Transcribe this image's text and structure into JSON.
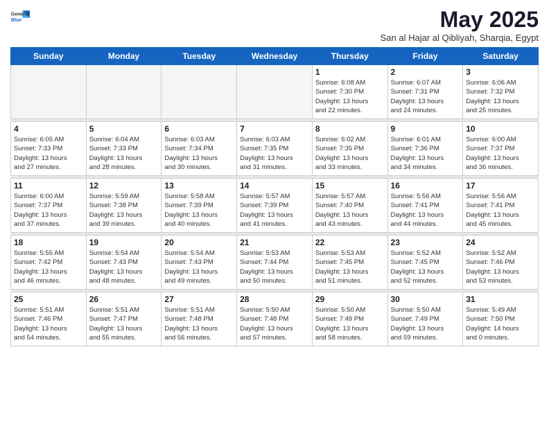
{
  "logo": {
    "general": "General",
    "blue": "Blue"
  },
  "title": "May 2025",
  "subtitle": "San al Hajar al Qibliyah, Sharqia, Egypt",
  "days_of_week": [
    "Sunday",
    "Monday",
    "Tuesday",
    "Wednesday",
    "Thursday",
    "Friday",
    "Saturday"
  ],
  "weeks": [
    [
      {
        "num": "",
        "info": ""
      },
      {
        "num": "",
        "info": ""
      },
      {
        "num": "",
        "info": ""
      },
      {
        "num": "",
        "info": ""
      },
      {
        "num": "1",
        "info": "Sunrise: 6:08 AM\nSunset: 7:30 PM\nDaylight: 13 hours\nand 22 minutes."
      },
      {
        "num": "2",
        "info": "Sunrise: 6:07 AM\nSunset: 7:31 PM\nDaylight: 13 hours\nand 24 minutes."
      },
      {
        "num": "3",
        "info": "Sunrise: 6:06 AM\nSunset: 7:32 PM\nDaylight: 13 hours\nand 25 minutes."
      }
    ],
    [
      {
        "num": "4",
        "info": "Sunrise: 6:05 AM\nSunset: 7:33 PM\nDaylight: 13 hours\nand 27 minutes."
      },
      {
        "num": "5",
        "info": "Sunrise: 6:04 AM\nSunset: 7:33 PM\nDaylight: 13 hours\nand 28 minutes."
      },
      {
        "num": "6",
        "info": "Sunrise: 6:03 AM\nSunset: 7:34 PM\nDaylight: 13 hours\nand 30 minutes."
      },
      {
        "num": "7",
        "info": "Sunrise: 6:03 AM\nSunset: 7:35 PM\nDaylight: 13 hours\nand 31 minutes."
      },
      {
        "num": "8",
        "info": "Sunrise: 6:02 AM\nSunset: 7:35 PM\nDaylight: 13 hours\nand 33 minutes."
      },
      {
        "num": "9",
        "info": "Sunrise: 6:01 AM\nSunset: 7:36 PM\nDaylight: 13 hours\nand 34 minutes."
      },
      {
        "num": "10",
        "info": "Sunrise: 6:00 AM\nSunset: 7:37 PM\nDaylight: 13 hours\nand 36 minutes."
      }
    ],
    [
      {
        "num": "11",
        "info": "Sunrise: 6:00 AM\nSunset: 7:37 PM\nDaylight: 13 hours\nand 37 minutes."
      },
      {
        "num": "12",
        "info": "Sunrise: 5:59 AM\nSunset: 7:38 PM\nDaylight: 13 hours\nand 39 minutes."
      },
      {
        "num": "13",
        "info": "Sunrise: 5:58 AM\nSunset: 7:39 PM\nDaylight: 13 hours\nand 40 minutes."
      },
      {
        "num": "14",
        "info": "Sunrise: 5:57 AM\nSunset: 7:39 PM\nDaylight: 13 hours\nand 41 minutes."
      },
      {
        "num": "15",
        "info": "Sunrise: 5:57 AM\nSunset: 7:40 PM\nDaylight: 13 hours\nand 43 minutes."
      },
      {
        "num": "16",
        "info": "Sunrise: 5:56 AM\nSunset: 7:41 PM\nDaylight: 13 hours\nand 44 minutes."
      },
      {
        "num": "17",
        "info": "Sunrise: 5:56 AM\nSunset: 7:41 PM\nDaylight: 13 hours\nand 45 minutes."
      }
    ],
    [
      {
        "num": "18",
        "info": "Sunrise: 5:55 AM\nSunset: 7:42 PM\nDaylight: 13 hours\nand 46 minutes."
      },
      {
        "num": "19",
        "info": "Sunrise: 5:54 AM\nSunset: 7:43 PM\nDaylight: 13 hours\nand 48 minutes."
      },
      {
        "num": "20",
        "info": "Sunrise: 5:54 AM\nSunset: 7:43 PM\nDaylight: 13 hours\nand 49 minutes."
      },
      {
        "num": "21",
        "info": "Sunrise: 5:53 AM\nSunset: 7:44 PM\nDaylight: 13 hours\nand 50 minutes."
      },
      {
        "num": "22",
        "info": "Sunrise: 5:53 AM\nSunset: 7:45 PM\nDaylight: 13 hours\nand 51 minutes."
      },
      {
        "num": "23",
        "info": "Sunrise: 5:52 AM\nSunset: 7:45 PM\nDaylight: 13 hours\nand 52 minutes."
      },
      {
        "num": "24",
        "info": "Sunrise: 5:52 AM\nSunset: 7:46 PM\nDaylight: 13 hours\nand 53 minutes."
      }
    ],
    [
      {
        "num": "25",
        "info": "Sunrise: 5:51 AM\nSunset: 7:46 PM\nDaylight: 13 hours\nand 54 minutes."
      },
      {
        "num": "26",
        "info": "Sunrise: 5:51 AM\nSunset: 7:47 PM\nDaylight: 13 hours\nand 55 minutes."
      },
      {
        "num": "27",
        "info": "Sunrise: 5:51 AM\nSunset: 7:48 PM\nDaylight: 13 hours\nand 56 minutes."
      },
      {
        "num": "28",
        "info": "Sunrise: 5:50 AM\nSunset: 7:48 PM\nDaylight: 13 hours\nand 57 minutes."
      },
      {
        "num": "29",
        "info": "Sunrise: 5:50 AM\nSunset: 7:49 PM\nDaylight: 13 hours\nand 58 minutes."
      },
      {
        "num": "30",
        "info": "Sunrise: 5:50 AM\nSunset: 7:49 PM\nDaylight: 13 hours\nand 59 minutes."
      },
      {
        "num": "31",
        "info": "Sunrise: 5:49 AM\nSunset: 7:50 PM\nDaylight: 14 hours\nand 0 minutes."
      }
    ]
  ]
}
